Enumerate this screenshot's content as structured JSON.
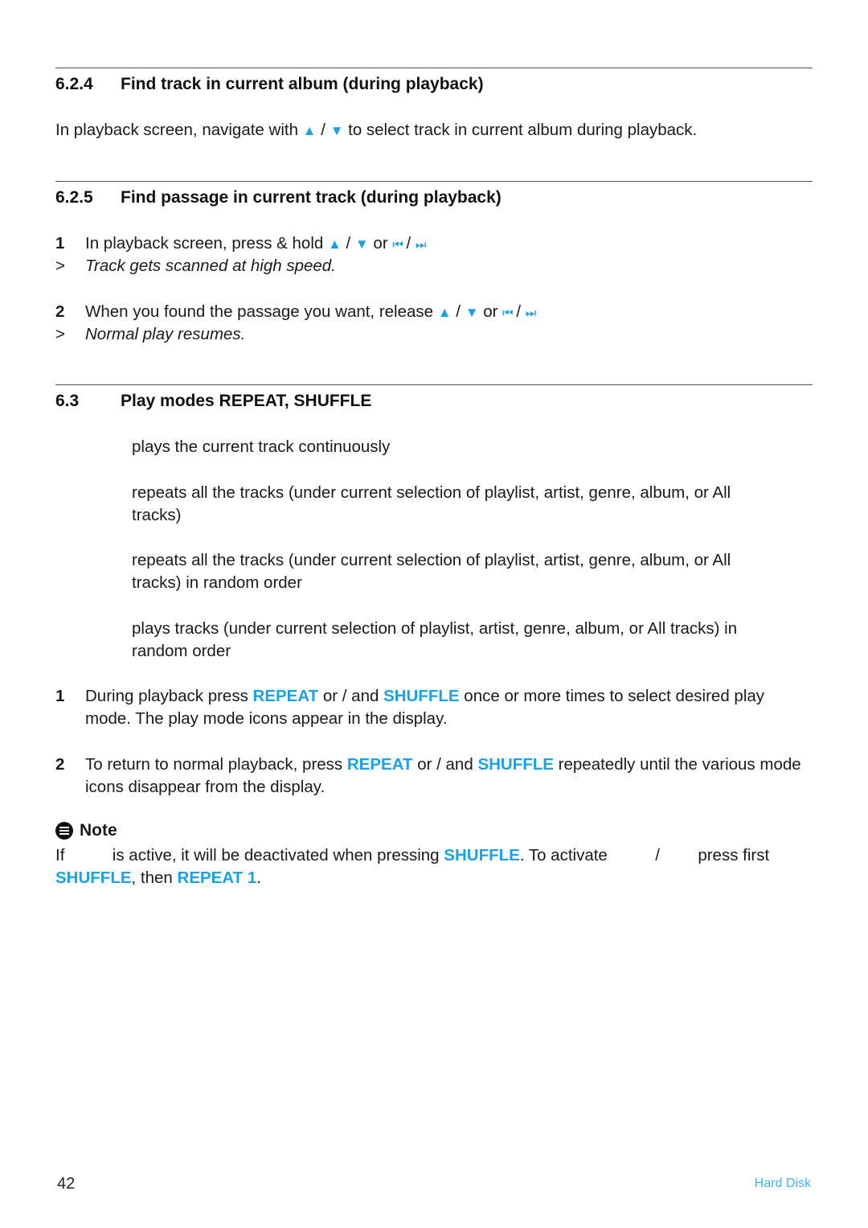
{
  "sections": {
    "s624": {
      "number": "6.2.4",
      "title": "Find track in current album (during playback)",
      "body_pre": "In playback screen, navigate with ",
      "sep": " / ",
      "body_post": " to select track in current album during playback."
    },
    "s625": {
      "number": "6.2.5",
      "title": "Find passage in current track (during playback)",
      "steps": [
        {
          "num": "1",
          "text": "In playback screen, press & hold ",
          "result": "Track gets scanned at high speed."
        },
        {
          "num": "2",
          "text": "When you found the passage you want, release ",
          "result": "Normal play resumes."
        }
      ],
      "or": " or ",
      "sep": " / ",
      "result_marker": ">"
    },
    "s63": {
      "number": "6.3",
      "title": "Play modes REPEAT, SHUFFLE",
      "modes": [
        "plays the current track continuously",
        "repeats all the tracks (under current selection of playlist, artist, genre, album, or All tracks)",
        "repeats all the tracks (under current selection of playlist, artist, genre, album, or All tracks) in random order",
        "plays tracks (under current selection of playlist, artist, genre, album, or All tracks) in random order"
      ],
      "steps": [
        {
          "num": "1",
          "pre": "During playback press ",
          "kw1": "REPEAT",
          "mid": " or / and ",
          "kw2": "SHUFFLE",
          "post": " once or more times to select desired play mode. The play mode icons appear in the display."
        },
        {
          "num": "2",
          "pre": "To return to normal playback, press ",
          "kw1": "REPEAT",
          "mid": " or / and ",
          "kw2": "SHUFFLE",
          "post": " repeatedly until the various mode icons disappear from the display."
        }
      ]
    }
  },
  "note": {
    "label": "Note",
    "p1": "If ",
    "p2": " is active, it will be deactivated when pressing ",
    "kw1": "SHUFFLE",
    "p3": ". To activate ",
    "p4": " / ",
    "p5": " press first ",
    "kw2": "SHUFFLE",
    "p6": ", then ",
    "kw3": "REPEAT 1",
    "p7": "."
  },
  "icons": {
    "up": "▲",
    "down": "▼",
    "prev": "⏮",
    "next": "⏭"
  },
  "footer": {
    "page_number": "42",
    "label": "Hard Disk"
  },
  "colors": {
    "accent": "#1aa1e6"
  }
}
